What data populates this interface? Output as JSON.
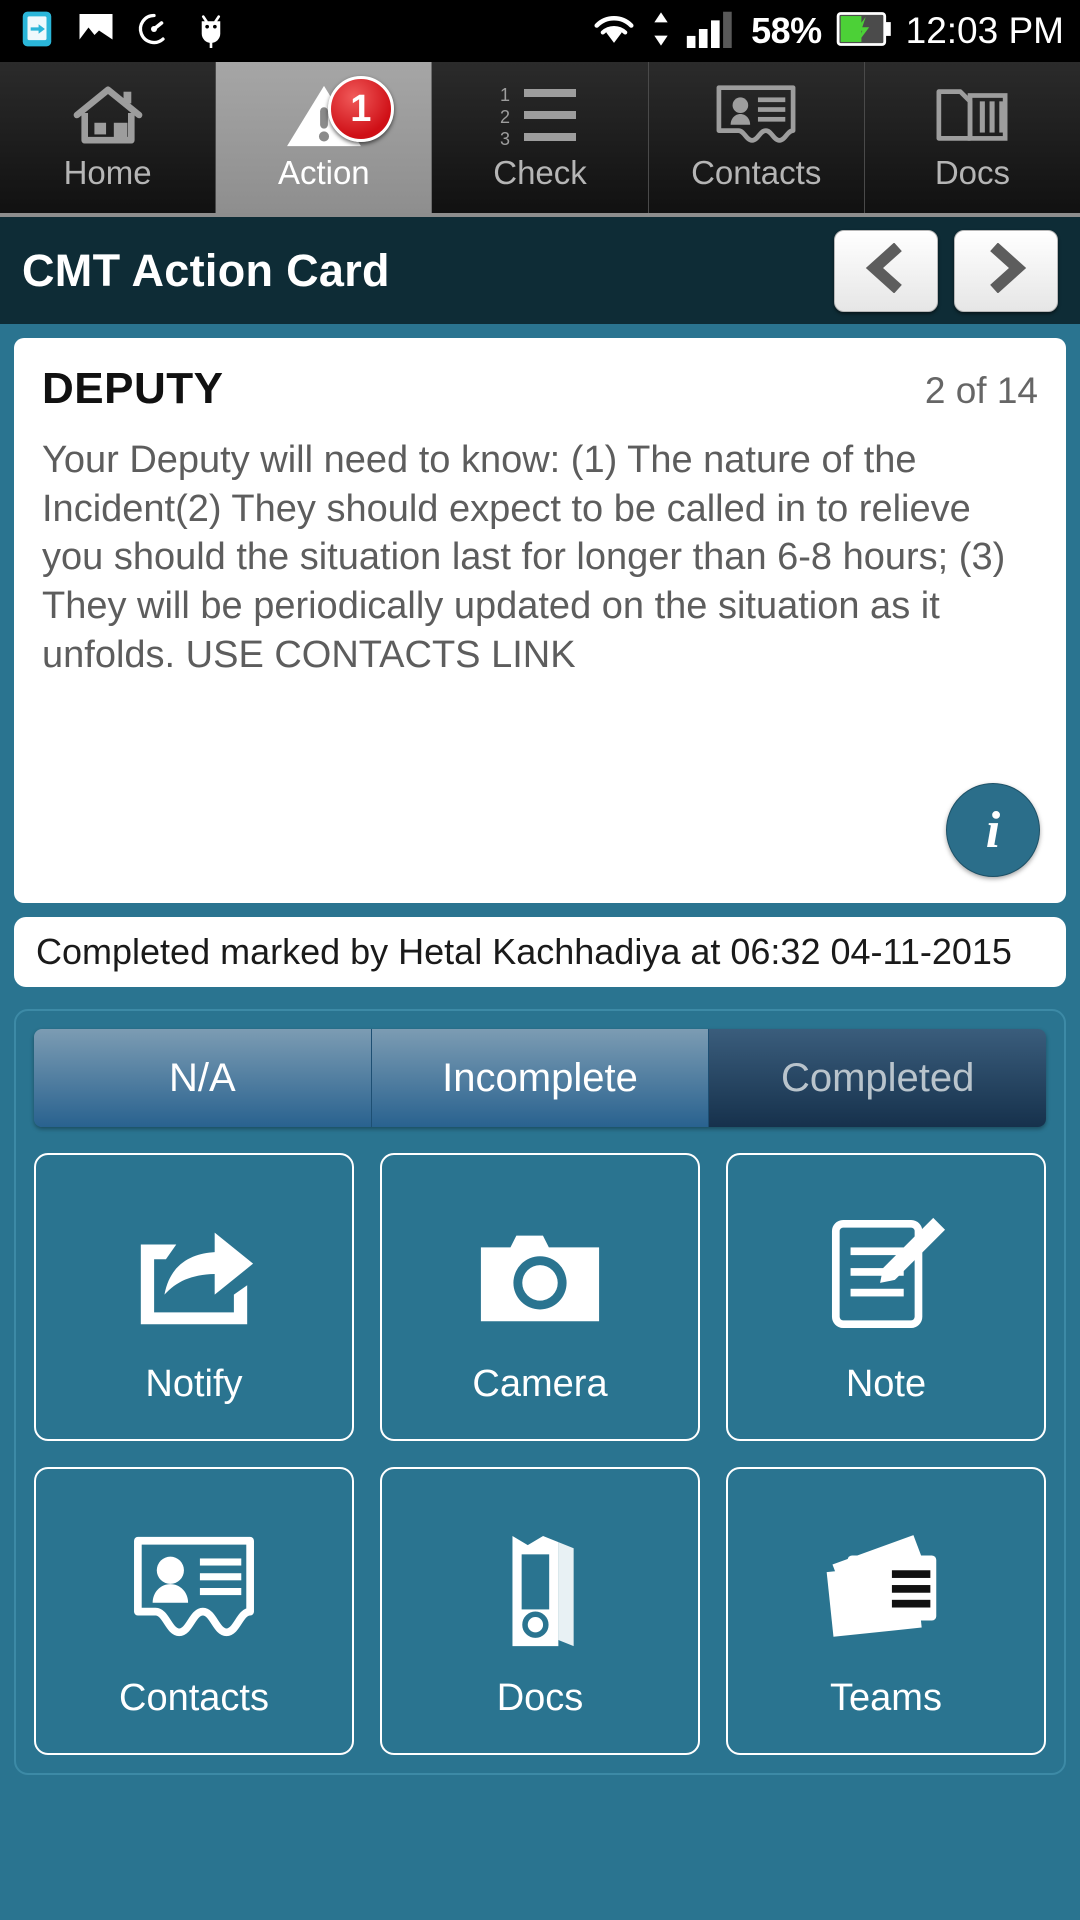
{
  "statusbar": {
    "icons": [
      "screen-share-icon",
      "image-icon",
      "speedometer-icon",
      "android-debug-icon",
      "wifi-icon",
      "data-transfer-icon",
      "signal-icon"
    ],
    "battery_percent": "58%",
    "battery_icon": "battery-charging-icon",
    "time": "12:03 PM"
  },
  "tabs": [
    {
      "label": "Home",
      "icon": "home-icon",
      "selected": false
    },
    {
      "label": "Action",
      "icon": "warning-triangle-icon",
      "selected": true,
      "badge": "1"
    },
    {
      "label": "Check",
      "icon": "numbered-list-icon",
      "selected": false
    },
    {
      "label": "Contacts",
      "icon": "contact-card-icon",
      "selected": false
    },
    {
      "label": "Docs",
      "icon": "documents-icon",
      "selected": false
    }
  ],
  "header": {
    "title": "CMT Action Card",
    "prev_icon": "chevron-left-icon",
    "next_icon": "chevron-right-icon"
  },
  "card": {
    "title": "DEPUTY",
    "count": "2 of 14",
    "body": "Your Deputy will need to know: (1) The nature of the Incident(2) They should expect to be called in to relieve you should the situation last for longer than 6-8 hours; (3) They will be periodically updated on the situation as it unfolds. USE CONTACTS LINK",
    "info_icon": "info-icon",
    "info_glyph": "i"
  },
  "status_strip": {
    "text": "Completed marked by Hetal Kachhadiya at 06:32 04-11-2015"
  },
  "segmented": {
    "options": [
      {
        "label": "N/A",
        "active": false
      },
      {
        "label": "Incomplete",
        "active": false
      },
      {
        "label": "Completed",
        "active": true
      }
    ]
  },
  "actions": [
    {
      "label": "Notify",
      "icon": "share-arrow-icon"
    },
    {
      "label": "Camera",
      "icon": "camera-icon"
    },
    {
      "label": "Note",
      "icon": "note-pen-icon"
    },
    {
      "label": "Contacts",
      "icon": "contact-card-icon"
    },
    {
      "label": "Docs",
      "icon": "binder-icon"
    },
    {
      "label": "Teams",
      "icon": "teams-cards-icon"
    }
  ],
  "colors": {
    "page_background": "#2a7490",
    "header_background": "#0e2c36",
    "badge_red": "#cf0f16",
    "accent_teal": "#2b6e8a"
  }
}
